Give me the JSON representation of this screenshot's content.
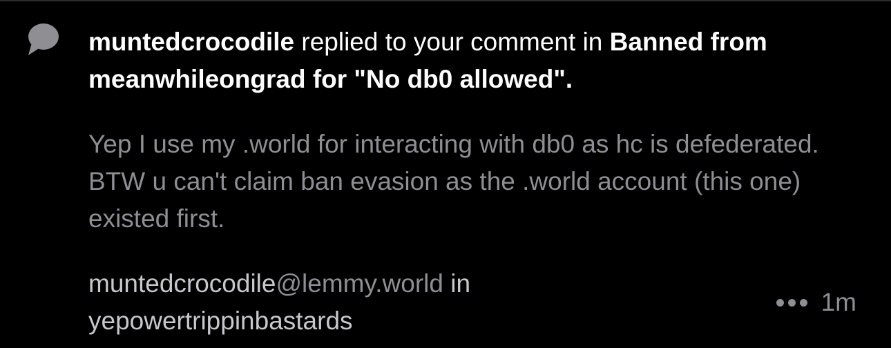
{
  "notification": {
    "icon": "speech-bubble-icon",
    "headline": {
      "actor": "muntedcrocodile",
      "action": " replied to your comment in ",
      "post_title": "Banned from meanwhileongrad for \"No db0 allowed\"",
      "end": "."
    },
    "body": "Yep I use my .world for interacting with db0 as hc is defederated. BTW u can't claim ban evasion as the .world account (this one) existed first.",
    "author": {
      "username": "muntedcrocodile",
      "instance": "@lemmy.world",
      "in_label": " in",
      "community": "yepowertrippinbastards"
    },
    "more_icon": "ellipsis-icon",
    "time": "1m"
  },
  "colors": {
    "background": "#000000",
    "primary_text": "#ffffff",
    "secondary_text": "#8e8e93",
    "icon": "#8e8e93"
  }
}
